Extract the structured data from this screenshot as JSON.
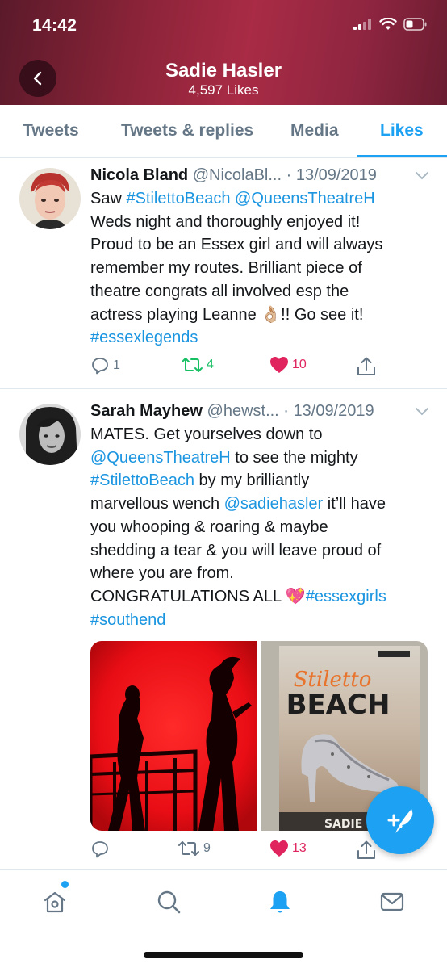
{
  "status_bar": {
    "time": "14:42"
  },
  "header": {
    "title": "Sadie Hasler",
    "subtitle": "4,597 Likes"
  },
  "tabs": [
    {
      "label": "Tweets",
      "active": false
    },
    {
      "label": "Tweets & replies",
      "active": false
    },
    {
      "label": "Media",
      "active": false
    },
    {
      "label": "Likes",
      "active": true
    }
  ],
  "tweets": [
    {
      "name": "Nicola Bland",
      "handle": "@NicolaBl...",
      "date": "· 13/09/2019",
      "lines": [
        [
          [
            "Saw ",
            "text"
          ],
          [
            "#StilettoBeach",
            "link"
          ],
          [
            " ",
            "text"
          ],
          [
            "@QueensTheatreH",
            "link"
          ]
        ],
        [
          [
            "Weds night and thoroughly enjoyed it!",
            "text"
          ]
        ],
        [
          [
            "Proud to be an Essex girl and will always",
            "text"
          ]
        ],
        [
          [
            "remember my routes. Brilliant piece of",
            "text"
          ]
        ],
        [
          [
            "theatre congrats all involved esp the",
            "text"
          ]
        ],
        [
          [
            "actress playing Leanne 👌🏼!! Go see it!",
            "text"
          ]
        ],
        [
          [
            "#essexlegends",
            "link"
          ]
        ]
      ],
      "replies": "1",
      "retweets": "4",
      "likes": "10"
    },
    {
      "name": "Sarah Mayhew",
      "handle": "@hewst...",
      "date": "· 13/09/2019",
      "lines": [
        [
          [
            "MATES. Get yourselves down to",
            "text"
          ]
        ],
        [
          [
            "@QueensTheatreH",
            "link"
          ],
          [
            " to see the mighty",
            "text"
          ]
        ],
        [
          [
            "#StilettoBeach",
            "link"
          ],
          [
            " by my brilliantly",
            "text"
          ]
        ],
        [
          [
            "marvellous wench ",
            "text"
          ],
          [
            "@sadiehasler",
            "link"
          ],
          [
            " it’ll have",
            "text"
          ]
        ],
        [
          [
            "you whooping & roaring & maybe",
            "text"
          ]
        ],
        [
          [
            "shedding a tear & you will leave proud of",
            "text"
          ]
        ],
        [
          [
            "where you are from.",
            "text"
          ]
        ],
        [
          [
            "CONGRATULATIONS ALL 💖",
            "text"
          ],
          [
            "#essexgirls",
            "link"
          ]
        ],
        [
          [
            "#southend",
            "link"
          ]
        ]
      ],
      "media_book": {
        "title_top": "Stiletto",
        "title_bottom": "BEACH",
        "author": "SADIE HASLE"
      },
      "replies": "",
      "retweets": "9",
      "likes": "13"
    }
  ],
  "colors": {
    "accent": "#1da1f2",
    "retweet": "#17bf63",
    "like": "#e0245e",
    "header": "#8a2338"
  },
  "icons": [
    "back-arrow-icon",
    "signal-icon",
    "wifi-icon",
    "battery-icon",
    "chevron-down-icon",
    "reply-icon",
    "retweet-icon",
    "heart-icon",
    "share-icon",
    "compose-icon",
    "home-icon",
    "search-icon",
    "notifications-icon",
    "messages-icon"
  ]
}
